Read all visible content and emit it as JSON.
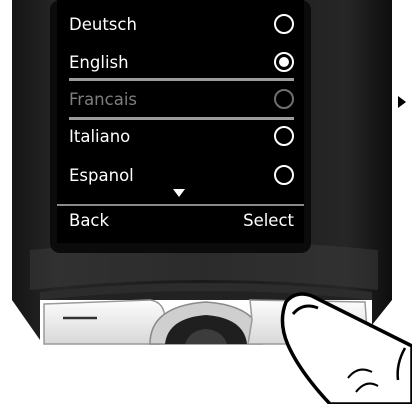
{
  "menu": {
    "items": [
      {
        "label": "Deutsch",
        "selected": false,
        "enabled": true
      },
      {
        "label": "English",
        "selected": true,
        "enabled": true
      },
      {
        "label": "Francais",
        "selected": false,
        "enabled": false
      },
      {
        "label": "Italiano",
        "selected": false,
        "enabled": true
      },
      {
        "label": "Espanol",
        "selected": false,
        "enabled": true
      }
    ],
    "scroll_indicator_icon": "arrow-down-icon"
  },
  "softkeys": {
    "left_label": "Back",
    "right_label": "Select"
  },
  "illustration": {
    "finger_icon": "finger-press-icon",
    "next_step_icon": "triangle-right-icon"
  }
}
